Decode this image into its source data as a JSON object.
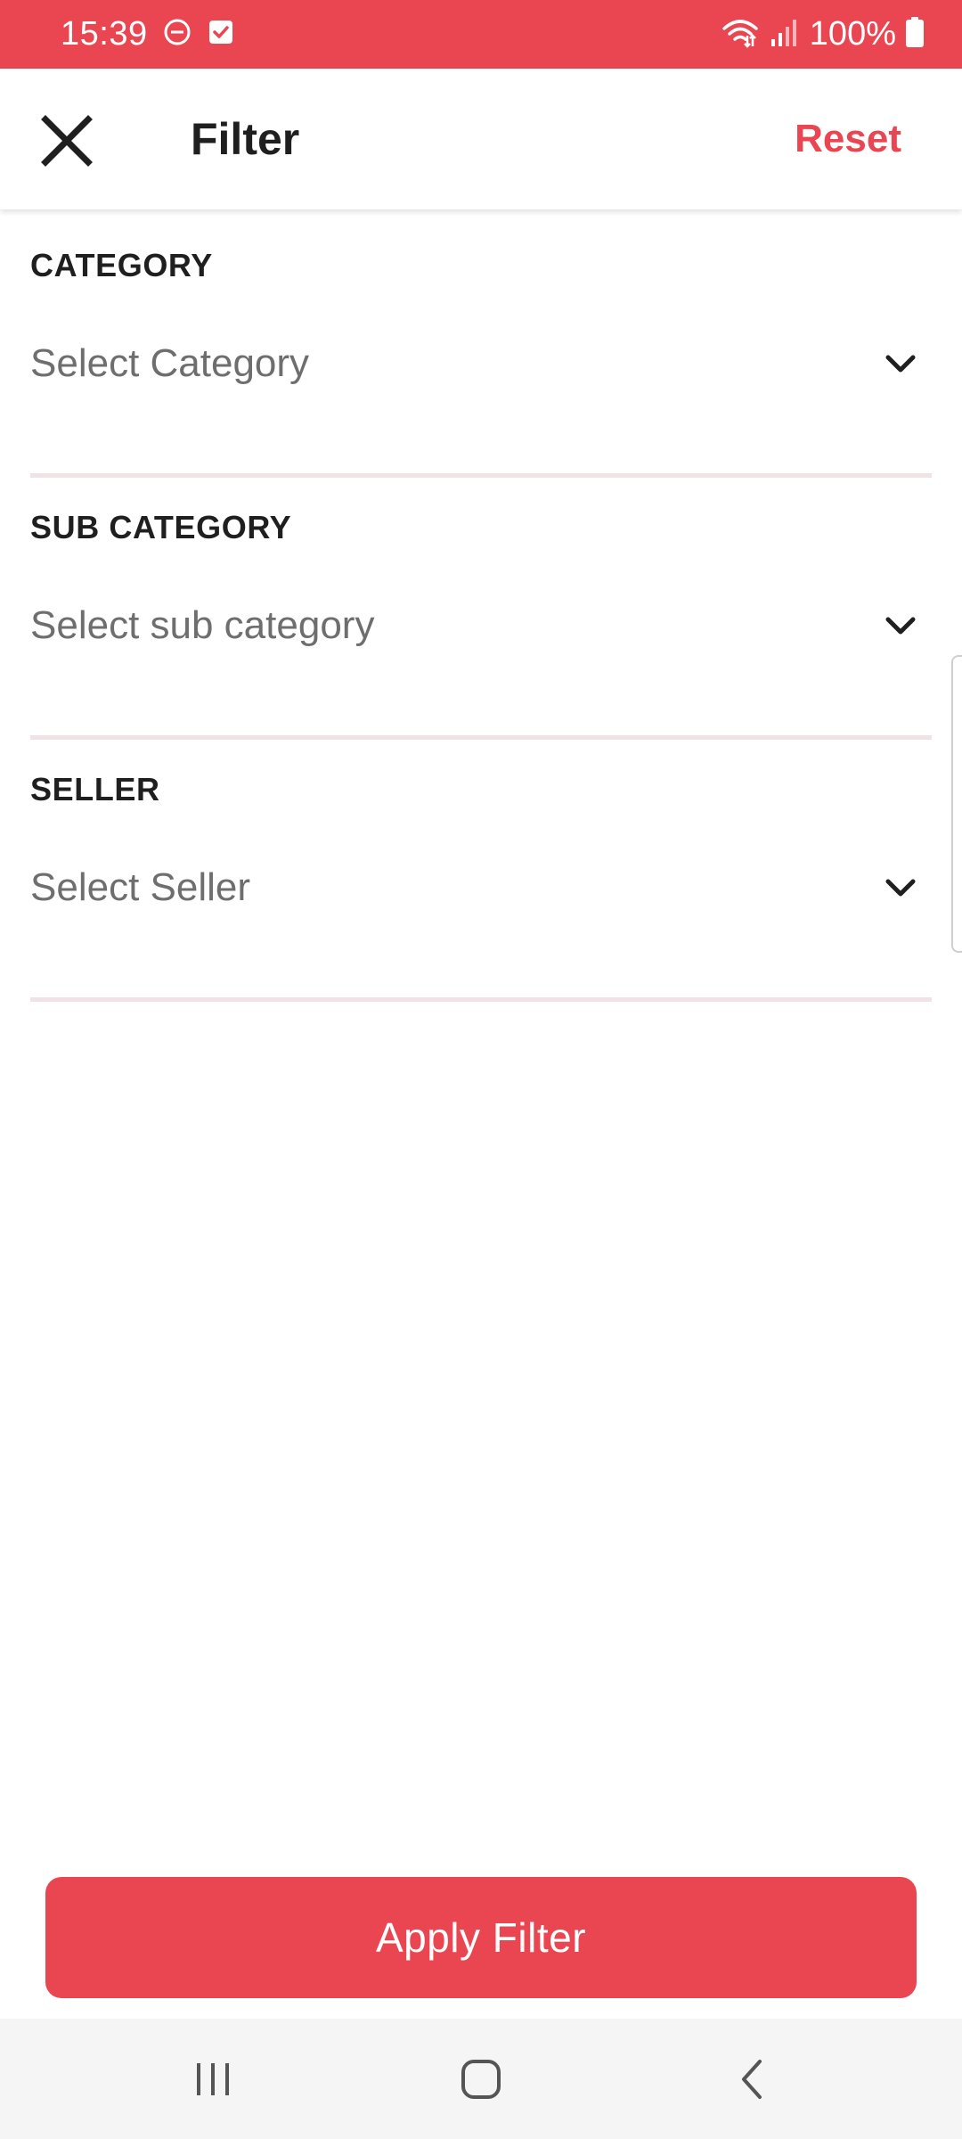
{
  "status_bar": {
    "time": "15:39",
    "battery": "100%",
    "icons": [
      "do-not-disturb-icon",
      "checkbox-notification-icon",
      "wifi-icon",
      "signal-icon",
      "battery-icon"
    ],
    "background": "#ea4651"
  },
  "header": {
    "title": "Filter",
    "reset_label": "Reset",
    "close_icon": "close-icon"
  },
  "filters": [
    {
      "label": "CATEGORY",
      "placeholder": "Select Category"
    },
    {
      "label": "SUB CATEGORY",
      "placeholder": "Select sub category"
    },
    {
      "label": "SELLER",
      "placeholder": "Select Seller"
    }
  ],
  "apply_button": {
    "label": "Apply Filter"
  },
  "nav_bar": {
    "icons": [
      "recent-apps-icon",
      "home-icon",
      "back-icon"
    ]
  },
  "colors": {
    "accent": "#ea4651",
    "divider": "#f0e2e5",
    "text_primary": "#1f1f1f",
    "text_placeholder": "#6e6e6e"
  }
}
